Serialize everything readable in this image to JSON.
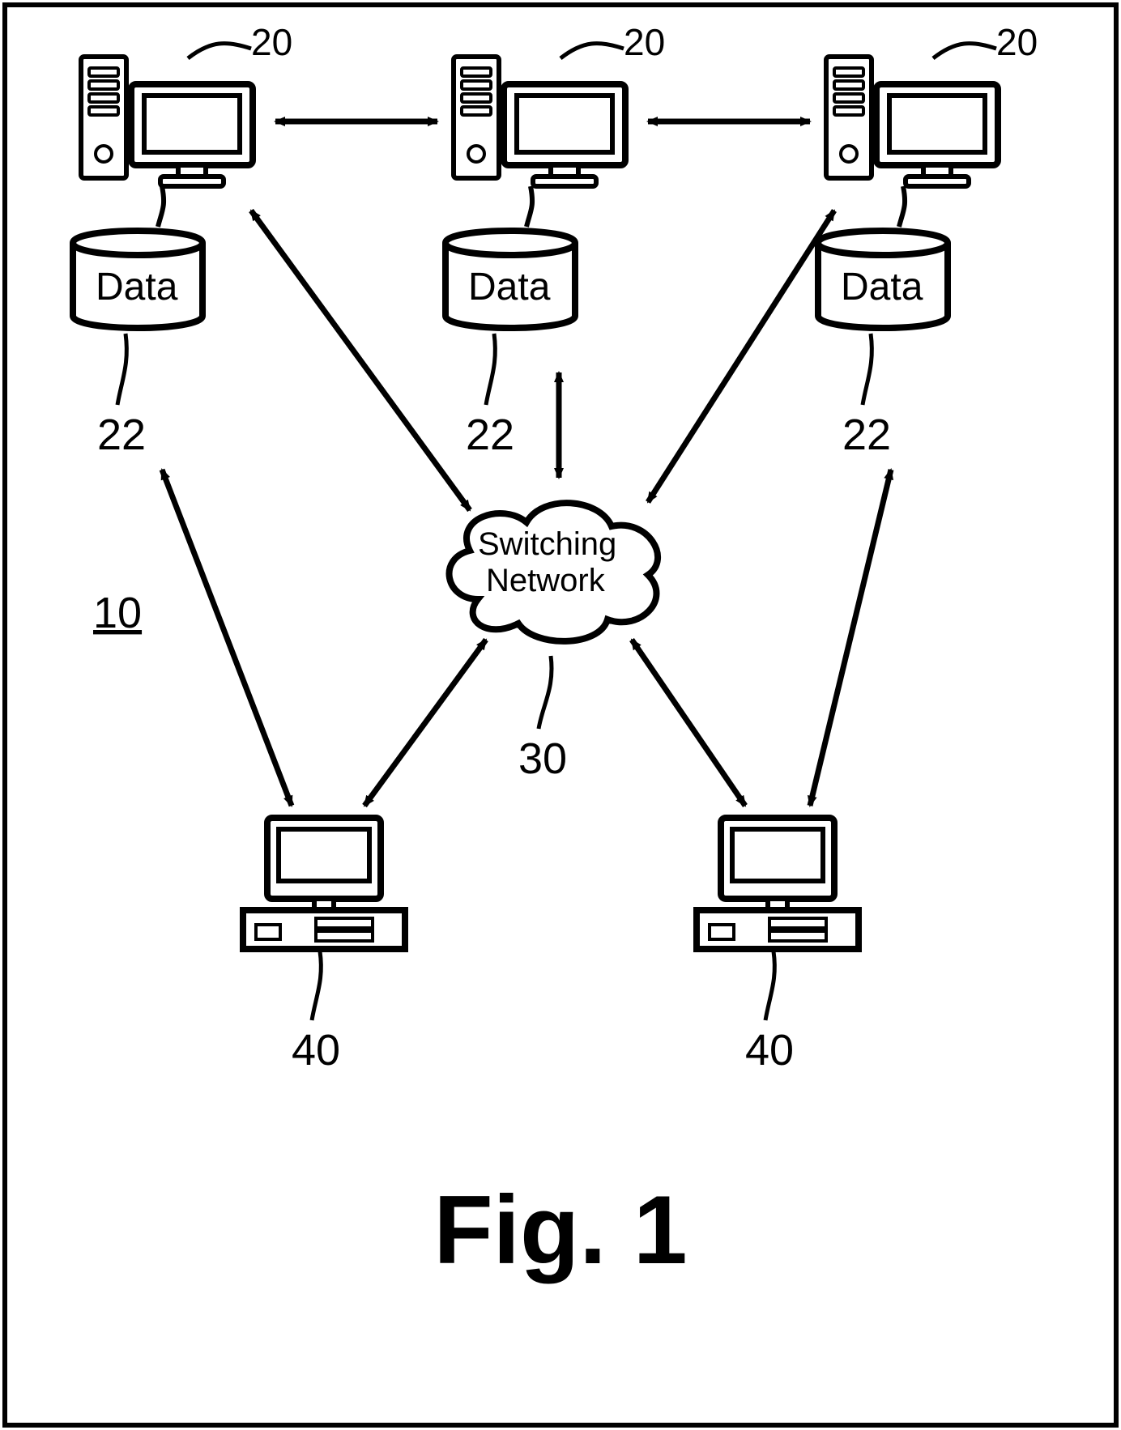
{
  "figure": {
    "id_label": "10",
    "caption": "Fig. 1",
    "server_label": "20",
    "db_label_num": "22",
    "db_text": "Data",
    "client_label": "40",
    "cloud_label_num": "30",
    "cloud_line1": "Switching",
    "cloud_line2": "Network"
  }
}
